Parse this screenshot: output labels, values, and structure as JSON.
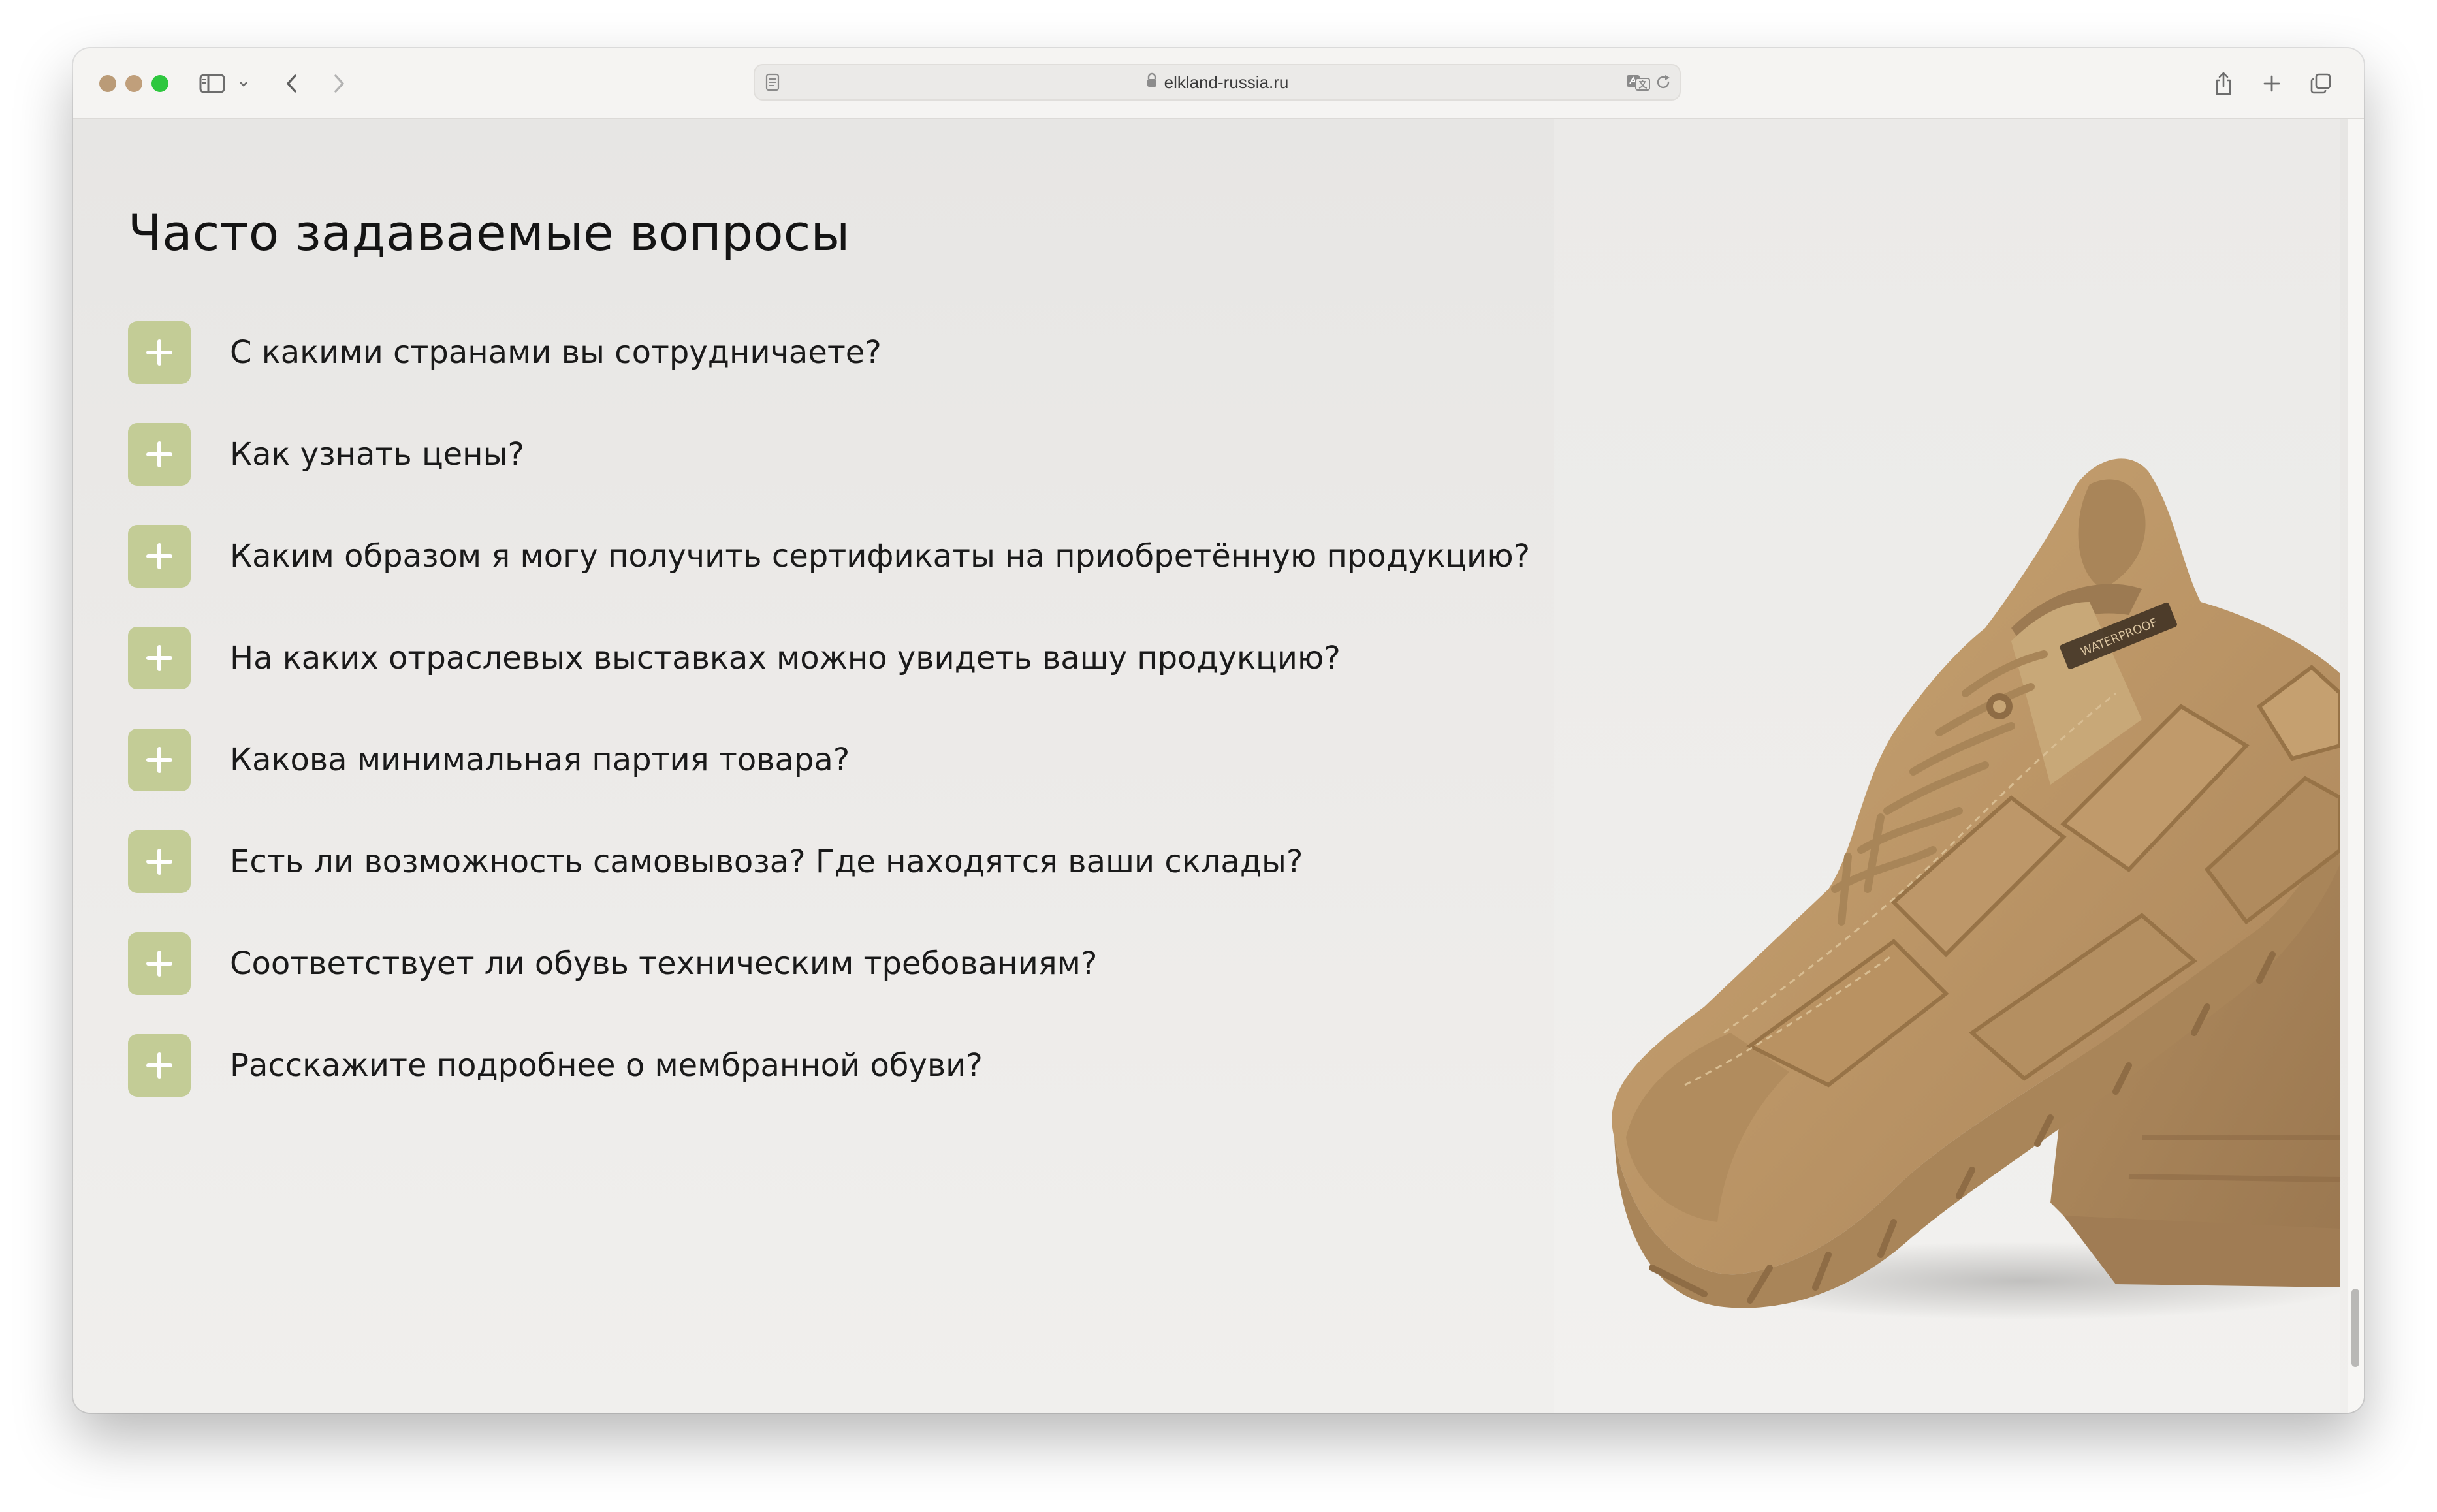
{
  "browser": {
    "url": "elkland-russia.ru",
    "icons": {
      "sidebar": "sidebar-icon",
      "chevron": "chevron-down-icon",
      "back": "back-icon",
      "forward": "forward-icon",
      "page": "page-icon",
      "lock": "lock-icon",
      "translate": "translate-icon",
      "reload": "reload-icon",
      "share": "share-icon",
      "new_tab": "plus-icon",
      "tabs": "tabs-overview-icon"
    }
  },
  "faq": {
    "title": "Часто задаваемые вопросы",
    "items": [
      {
        "question": "С какими странами вы сотрудничаете?"
      },
      {
        "question": "Как узнать цены?"
      },
      {
        "question": "Каким образом я могу получить сертификаты на приобретённую продукцию?"
      },
      {
        "question": "На каких отраслевых выставках можно увидеть вашу продукцию?"
      },
      {
        "question": "Какова минимальная партия товара?"
      },
      {
        "question": "Есть ли возможность самовывоза? Где находятся ваши склады?"
      },
      {
        "question": "Соответствует ли обувь техническим требованиям?"
      },
      {
        "question": "Расскажите подробнее о мембранной обуви?"
      }
    ]
  },
  "hero": {
    "shoe_print": "WATERPROOF"
  },
  "colors": {
    "accent": "#c3cc96",
    "background": "#ebeae8",
    "shoe": "#bf9a6c"
  }
}
